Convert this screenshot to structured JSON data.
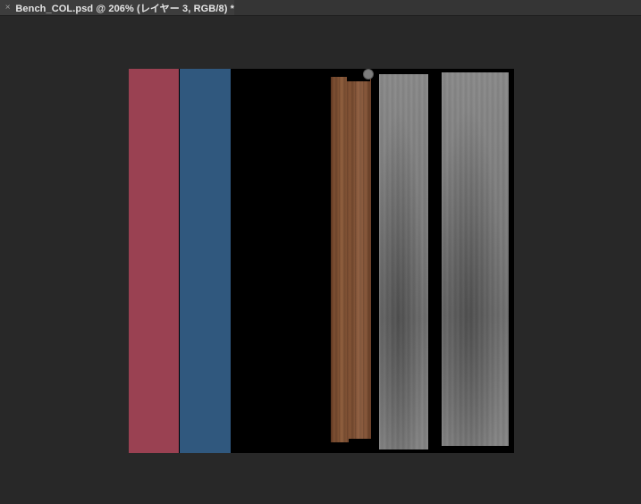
{
  "tab": {
    "close_glyph": "×",
    "title": "Bench_COL.psd @ 206% (レイヤー 3, RGB/8) *"
  },
  "canvas": {
    "background": "#282828",
    "document_background": "#000000"
  },
  "swatches": {
    "red": "#9a4152",
    "blue": "#30587e"
  },
  "icons": {
    "close": "close-icon",
    "pin": "pin-icon"
  }
}
